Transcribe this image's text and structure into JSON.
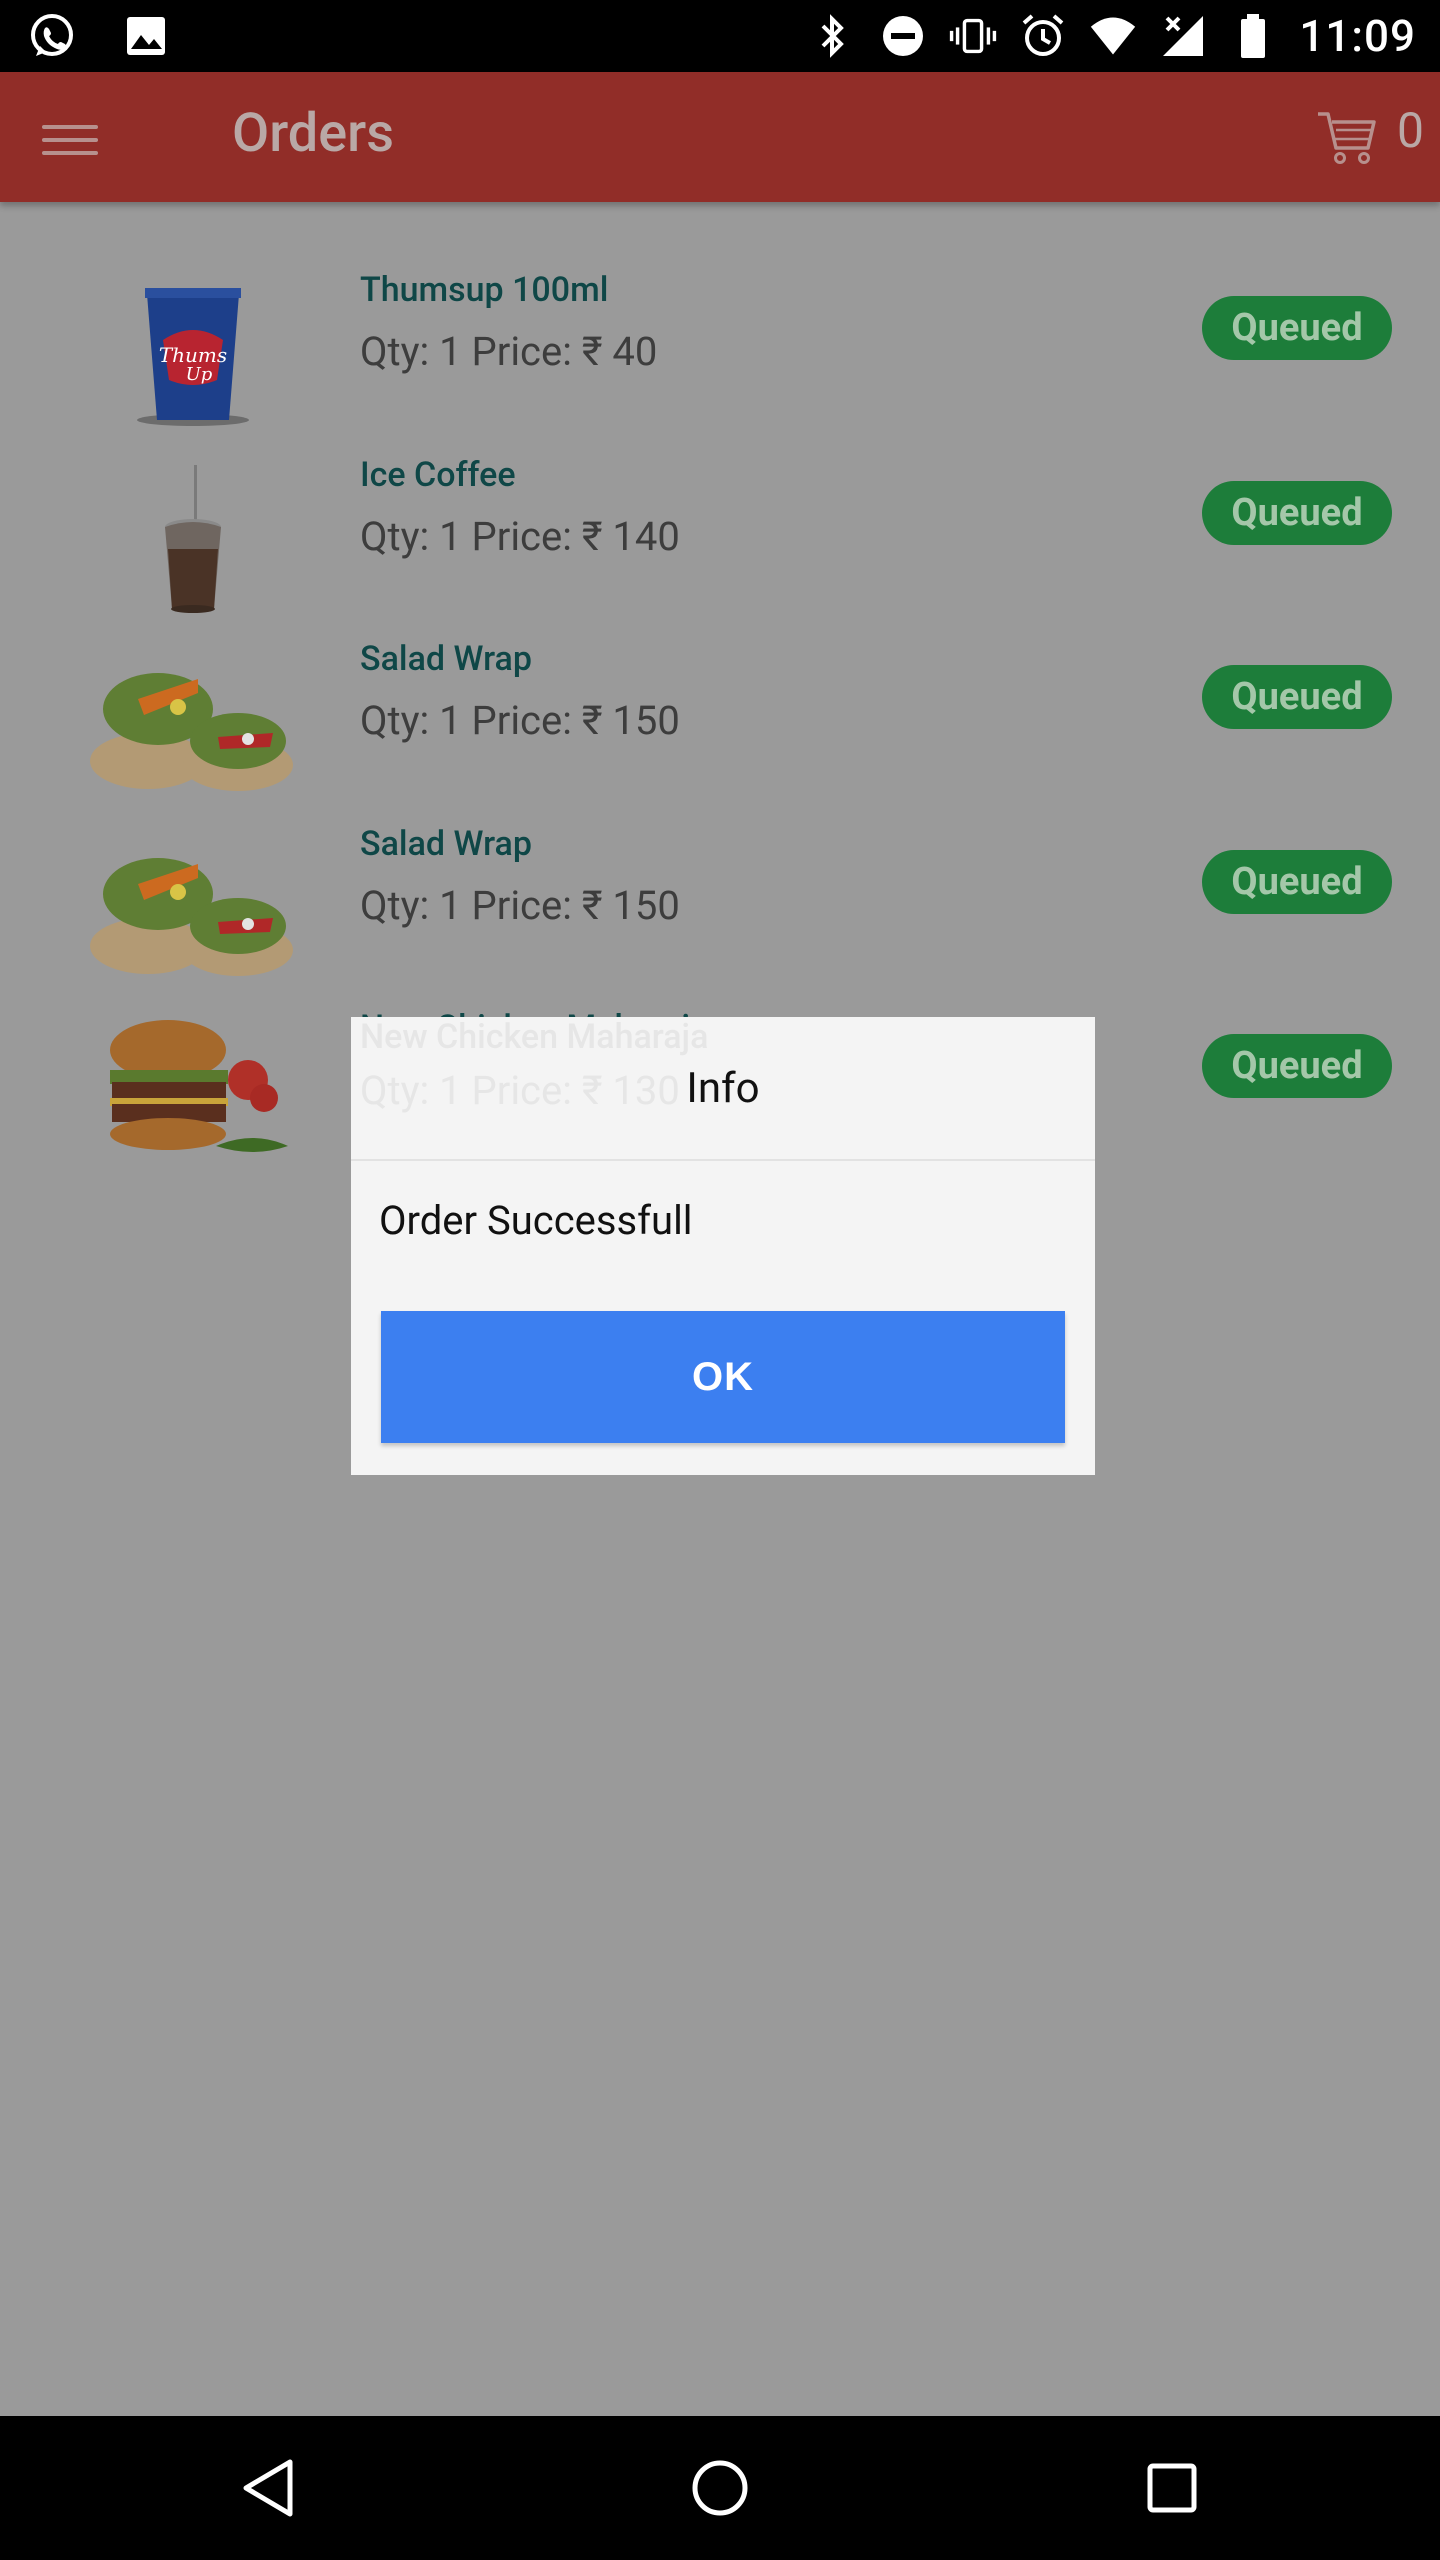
{
  "status_bar": {
    "time": "11:09",
    "left_icons": [
      "whatsapp-icon",
      "image-icon"
    ],
    "right_icons": [
      "bluetooth-icon",
      "do-not-disturb-icon",
      "vibrate-icon",
      "alarm-icon",
      "wifi-icon",
      "signal-icon",
      "battery-icon"
    ]
  },
  "app_bar": {
    "title": "Orders",
    "cart_count": "0",
    "colors": {
      "background": "#912d28",
      "title": "#b9a8a6"
    }
  },
  "orders": [
    {
      "name": "Thumsup 100ml",
      "meta": "Qty: 1 Price: ₹ 40",
      "status": "Queued",
      "image": "thumsup-cup-icon"
    },
    {
      "name": "Ice Coffee",
      "meta": "Qty: 1 Price: ₹ 140",
      "status": "Queued",
      "image": "ice-coffee-icon"
    },
    {
      "name": "Salad Wrap",
      "meta": "Qty: 1 Price: ₹ 150",
      "status": "Queued",
      "image": "salad-wrap-icon"
    },
    {
      "name": "Salad Wrap",
      "meta": "Qty: 1 Price: ₹ 150",
      "status": "Queued",
      "image": "salad-wrap-icon"
    },
    {
      "name": "New Chicken Maharaja",
      "meta": "Qty: 1 Price: ₹ 130",
      "status": "Queued",
      "image": "burger-icon"
    }
  ],
  "dialog": {
    "title": "Info",
    "message": "Order Successfull",
    "ok_label": "OK",
    "colors": {
      "button": "#3c7ff0"
    }
  },
  "nav_bar": {
    "buttons": [
      "back-icon",
      "home-icon",
      "recents-icon"
    ]
  }
}
